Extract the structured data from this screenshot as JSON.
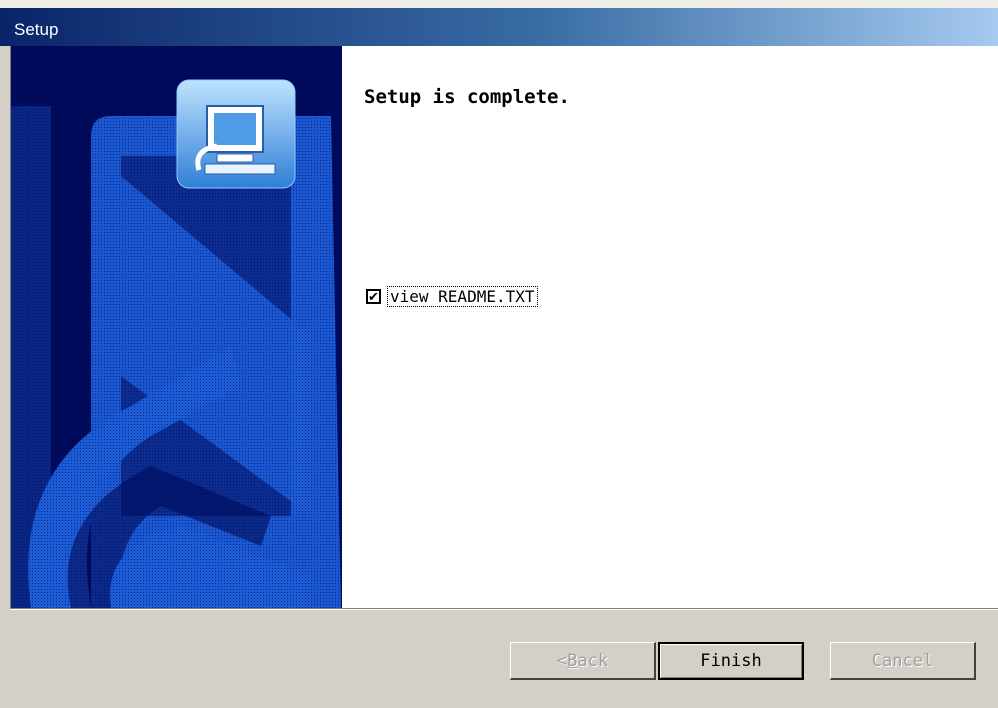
{
  "window": {
    "title": "Setup"
  },
  "main": {
    "heading": "Setup is complete.",
    "checkbox": {
      "label": "view README.TXT",
      "checked": true,
      "check_glyph": "✔"
    }
  },
  "buttons": {
    "back": {
      "prefix": "< ",
      "mnemonic": "B",
      "rest": "ack",
      "enabled": false
    },
    "finish": {
      "label": "Finish",
      "enabled": true
    },
    "cancel": {
      "label": "Cancel",
      "enabled": false
    }
  },
  "icons": {
    "banner": "installer-banner-graphic",
    "computer": "computer-icon"
  },
  "colors": {
    "title_gradient_start": "#0a246a",
    "title_gradient_end": "#a6caf0",
    "banner_bg": "#000a5a",
    "banner_blue": "#1c5bd6",
    "dialog_bg": "#d4d0c8"
  }
}
